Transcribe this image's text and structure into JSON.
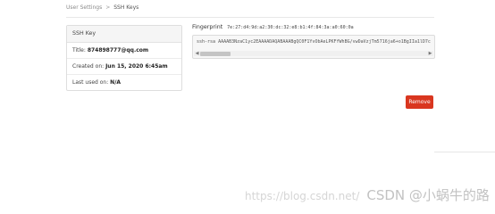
{
  "breadcrumb": {
    "parent": "User Settings",
    "separator": ">",
    "current": "SSH Keys"
  },
  "card": {
    "header": "SSH Key",
    "title_label": "Title:",
    "title_value": "874898777@qq.com",
    "created_label": "Created on:",
    "created_value": "Jun 15, 2020 6:45am",
    "last_used_label": "Last used on:",
    "last_used_value": "N/A"
  },
  "fingerprint": {
    "label": "Fingerprint",
    "value": "7e:27:d4:9d:a2:30:dc:32:e8:b1:4f:84:3a:a0:60:0a"
  },
  "public_key": {
    "text": "ssh-rsa AAAAB3NzaC1yc2EAAAADAQABAAABgQC0F1YvObAeLPKFfWhBG/vwDaVzjTm5716ja6+o1BgIIa1lD7c"
  },
  "actions": {
    "remove_label": "Remove"
  },
  "watermark": {
    "url": "https://blog.csdn.net/",
    "brand": "CSDN @小蜗牛的路"
  },
  "colors": {
    "remove_button": "#d9361f"
  }
}
